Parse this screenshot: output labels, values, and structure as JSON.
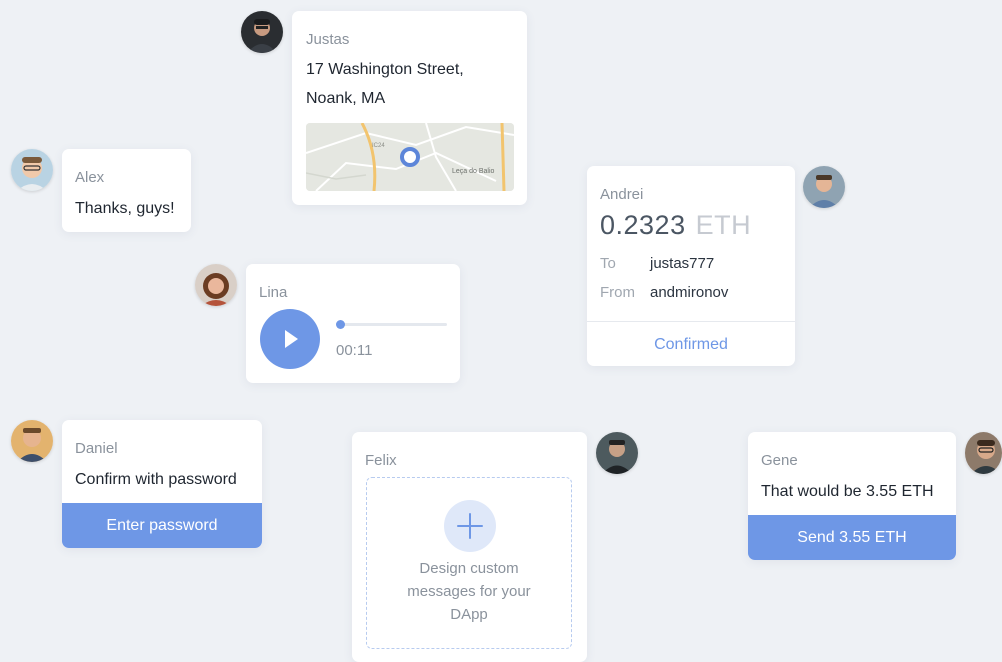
{
  "colors": {
    "background": "#eef1f5",
    "accent": "#6e97e6",
    "muted_text": "#8a929c",
    "eth_unit": "#c6cad1"
  },
  "justas": {
    "sender": "Justas",
    "address_line1": "17 Washington Street,",
    "address_line2": "Noank, MA",
    "map_label_place": "Leça do Balio",
    "map_label_road": "IC24"
  },
  "alex": {
    "sender": "Alex",
    "message": "Thanks, guys!"
  },
  "lina": {
    "sender": "Lina",
    "duration": "00:11",
    "progress": 0.0,
    "play_icon": "play-icon"
  },
  "andrei": {
    "sender": "Andrei",
    "amount": "0.2323",
    "unit": "ETH",
    "to_label": "To",
    "to_value": "justas777",
    "from_label": "From",
    "from_value": "andmironov",
    "status": "Confirmed"
  },
  "daniel": {
    "sender": "Daniel",
    "message": "Confirm with password",
    "button": "Enter password"
  },
  "felix": {
    "sender": "Felix",
    "cta_line1": "Design custom",
    "cta_line2": "messages for your",
    "cta_line3": "DApp",
    "icon": "plus-icon"
  },
  "gene": {
    "sender": "Gene",
    "message": "That would be 3.55 ETH",
    "button": "Send 3.55 ETH"
  }
}
